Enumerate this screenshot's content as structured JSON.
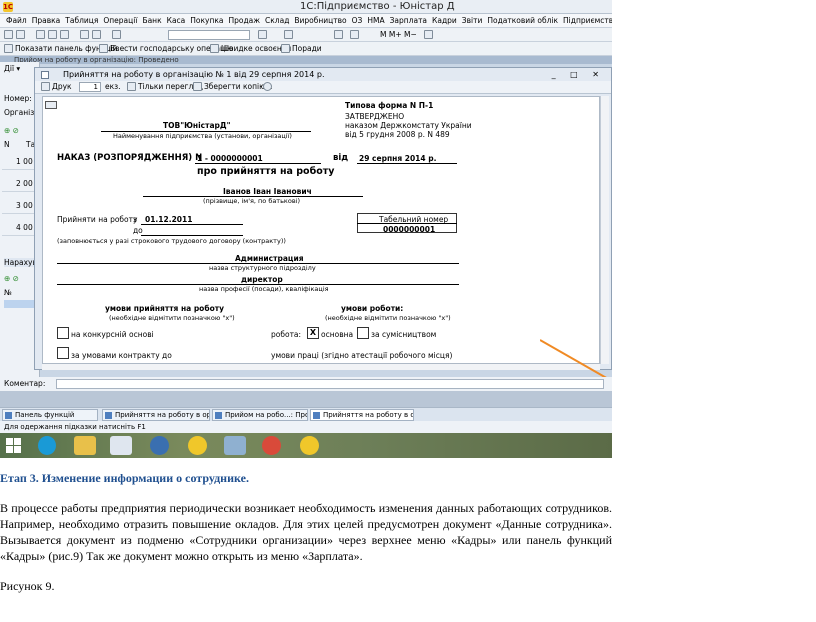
{
  "app": {
    "title": "1С:Підприємство - Юністар Д",
    "logo": "1С"
  },
  "menu": [
    "Файл",
    "Правка",
    "Таблиця",
    "Операції",
    "Банк",
    "Каса",
    "Покупка",
    "Продаж",
    "Склад",
    "Виробництво",
    "ОЗ",
    "НМА",
    "Зарплата",
    "Кадри",
    "Звіти",
    "Податковий облік",
    "Підприємство",
    "Сервіс",
    "Вікна",
    "Довідка"
  ],
  "toolbar2": {
    "show_panel": "Показати панель функцій",
    "enter_ops": "Ввести господарську операцію",
    "quick": "Швидке освоєння",
    "tips": "Поради"
  },
  "bg_doc_title": "Прийом на роботу в організацію: Проведено",
  "left_form": {
    "number": "Номер:",
    "org": "Організац",
    "col_n": "N",
    "col_t": "Та",
    "rows": [
      "1",
      "2",
      "3",
      "4"
    ],
    "row_vals": [
      "00",
      "00",
      "00",
      "00"
    ],
    "accruals": "Нарахув",
    "col_no": "№"
  },
  "print_window": {
    "title": "Прийняття на роботу в організацію  № 1 від 29 серпня 2014 р.",
    "print": "Друк",
    "copies": "1",
    "copies_suffix": "екз.",
    "view_only": "Тільки перегляд",
    "save_as": "Зберегти копію..."
  },
  "doc": {
    "form_title": "Типова форма N П-1",
    "approved": "ЗАТВЕРДЖЕНО",
    "order_line": "наказом Держкомстату України",
    "order_date": "від 5 грудня 2008 р. N 489",
    "org_name": "ТОВ\"ЮністарД\"",
    "org_caption": "Найменування підприємства (установи, організації)",
    "order_label": "НАКАЗ (РОЗПОРЯДЖЕННЯ) N",
    "order_number": "1 - 0000000001",
    "date_prefix": "від",
    "order_doc_date": "29 серпня 2014 р.",
    "subject": "про прийняття на роботу",
    "employee": "Іванов Іван Іванович",
    "employee_caption": "(прізвище, ім'я, по батькові)",
    "hire_label": "Прийняти на роботу",
    "from": "з",
    "hire_date": "01.12.2011",
    "to": "до",
    "fill_note": "(заповнюється у разі строкового трудового договору (контракту))",
    "tab_label": "Табельний номер",
    "tab_number": "0000000001",
    "dept": "Администрация",
    "dept_caption": "назва структурного підрозділу",
    "position": "директор",
    "position_caption": "назва професії (посади), кваліфікація",
    "hire_conditions": "умови прийняття на роботу",
    "hire_conditions_note": "(необхідне відмітити позначкою \"x\")",
    "work_conditions": "умови роботи:",
    "work_conditions_note": "(необхідне відмітити позначкою \"x\")",
    "competitive": "на конкурсній основі",
    "work_label": "робота:",
    "main_mark": "X",
    "main": "основна",
    "combo": "за сумісництвом",
    "contract": "за умовами контракту до",
    "work_terms": "умови праці (згідно атестації робочого місця)"
  },
  "comment_label": "Коментар:",
  "window_tabs": [
    "Панель функцій",
    "Прийняття на роботу в органі...",
    "Прийом на робо...: Проведено",
    "Прийняття на роботу в орг..."
  ],
  "status": "Для одержання підказки натисніть F1",
  "article": {
    "heading": "Етап 3. Изменение  информации о сотруднике.",
    "body": "В процессе работы предприятия периодически возникает необходимость изменения данных работающих сотрудников. Например, необходимо отразить повышение окладов. Для этих целей предусмотрен документ «Данные сотрудника». Вызывается документ из подменю «Сотрудники организации» через верхнее меню «Кадры» или панель функций «Кадры» (рис.9)  Так же документ можно открыть из меню «Зарплата».",
    "caption": "Рисунок 9."
  },
  "colors": {
    "accent": "#1f4f8f",
    "arrow": "#f08a24"
  }
}
